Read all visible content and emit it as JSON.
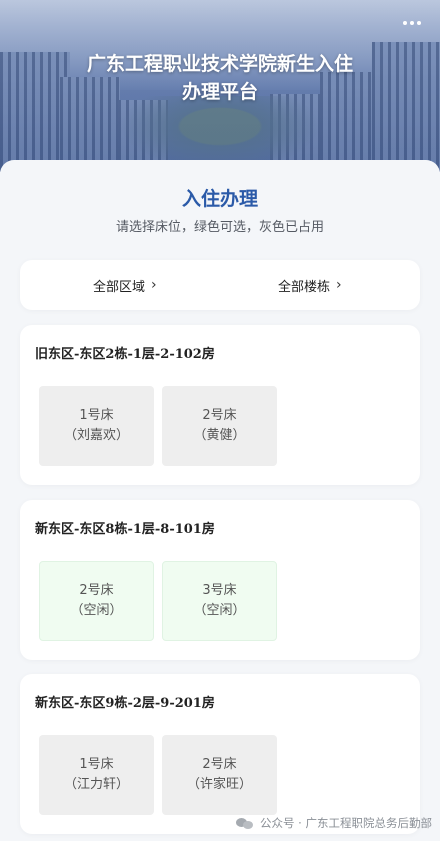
{
  "header": {
    "title": "广东工程职业技术学院新生入住\n办理平台",
    "more_icon": "more-dots-icon"
  },
  "page": {
    "title": "入住办理",
    "subtitle": "请选择床位，绿色可选，灰色已占用"
  },
  "filters": {
    "area_label": "全部区域",
    "building_label": "全部楼栋",
    "chevron": "›"
  },
  "colors": {
    "accent": "#2b5aa8",
    "free_bed": "#f0fcf1",
    "occupied_bed": "#eeeeee"
  },
  "rooms": [
    {
      "title": "旧东区-东区2栋-1层-2-102房",
      "beds": [
        {
          "bed": "1号床",
          "occupant": "（刘嘉欢）",
          "status": "occupied"
        },
        {
          "bed": "2号床",
          "occupant": "（黄健）",
          "status": "occupied"
        }
      ]
    },
    {
      "title": "新东区-东区8栋-1层-8-101房",
      "beds": [
        {
          "bed": "2号床",
          "occupant": "（空闲）",
          "status": "free"
        },
        {
          "bed": "3号床",
          "occupant": "（空闲）",
          "status": "free"
        }
      ]
    },
    {
      "title": "新东区-东区9栋-2层-9-201房",
      "beds": [
        {
          "bed": "1号床",
          "occupant": "（江力轩）",
          "status": "occupied"
        },
        {
          "bed": "2号床",
          "occupant": "（许家旺）",
          "status": "occupied"
        }
      ]
    }
  ],
  "watermark": {
    "text": "公众号 · 广东工程职院总务后勤部",
    "icon": "wechat-icon"
  }
}
